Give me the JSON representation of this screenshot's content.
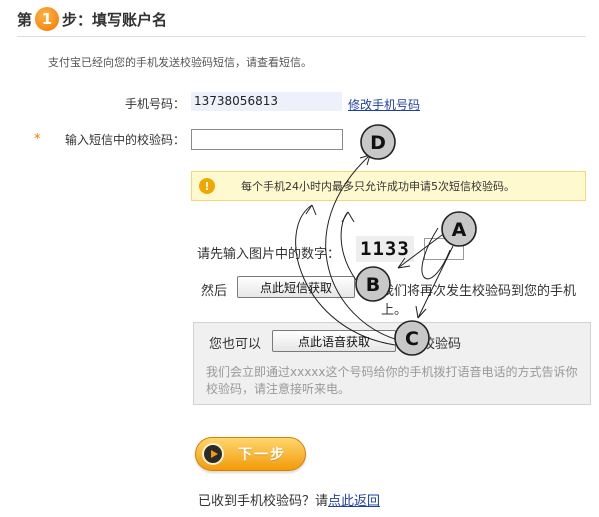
{
  "step": {
    "prefix": "第",
    "number": "1",
    "suffix": "步：填写账户名"
  },
  "intro": "支付宝已经向您的手机发送校验码短信，请查看短信。",
  "phone": {
    "label": "手机号码：",
    "value": "13738056813",
    "edit_link": "修改手机号码"
  },
  "sms_code": {
    "asterisk": "*",
    "label": "输入短信中的校验码：",
    "value": ""
  },
  "notice": {
    "icon": "!",
    "text": "每个手机24小时内最多只允许成功申请5次短信校验码。"
  },
  "captcha": {
    "label": "请先输入图片中的数字：",
    "image_text": "1133",
    "value": ""
  },
  "sms_resend": {
    "prefix": "然后",
    "button": "点此短信获取",
    "suffix": "我们将再次发生校验码到您的手机上。"
  },
  "voice": {
    "prefix": "您也可以",
    "button": "点此语音获取",
    "suffix": "校验码",
    "description": "我们会立即通过xxxxx这个号码给你的手机拨打语音电话的方式告诉你校验码，请注意接听来电。"
  },
  "next_button": "下一步",
  "bottom": {
    "text": "已收到手机校验码？请",
    "link": "点此返回"
  },
  "annotations": {
    "a": "A",
    "b": "B",
    "c": "C",
    "d": "D"
  }
}
